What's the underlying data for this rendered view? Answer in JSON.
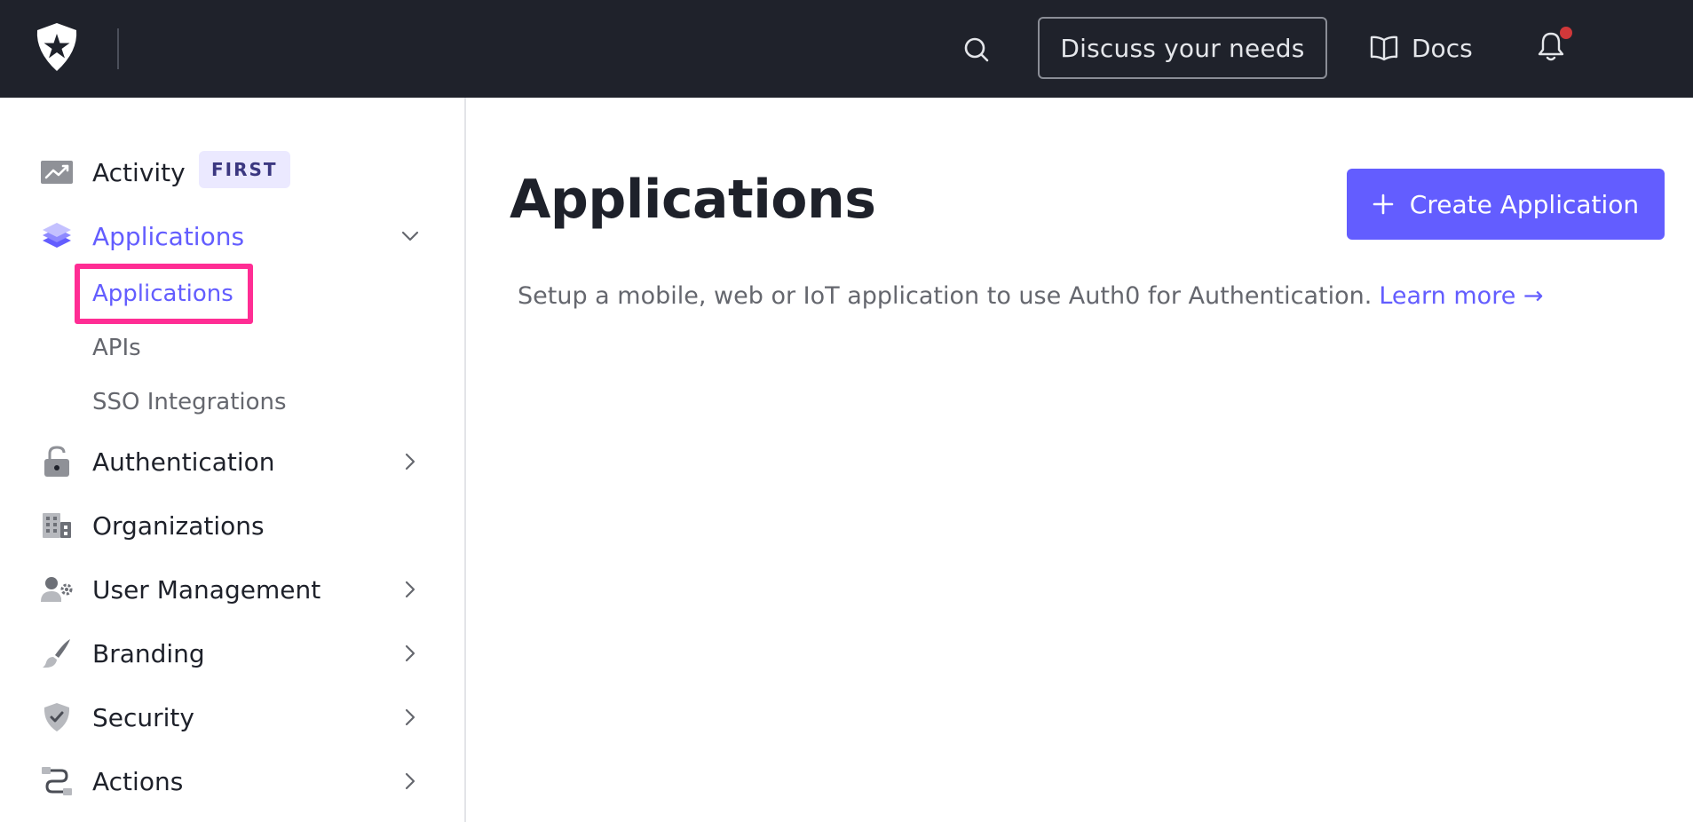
{
  "topbar": {
    "logo_icon": "auth0-star-shield-icon",
    "search_icon": "search-icon",
    "discuss_label": "Discuss your needs",
    "docs_label": "Docs",
    "docs_icon": "book-icon",
    "bell_icon": "bell-icon",
    "has_notification": true
  },
  "sidebar": {
    "items": [
      {
        "label": "Activity",
        "icon": "trending-chart-icon",
        "badge": "FIRST",
        "chevron": null
      },
      {
        "label": "Applications",
        "icon": "layers-icon",
        "active": true,
        "chevron": "chevron-down-icon",
        "children": [
          {
            "label": "Applications",
            "active": true
          },
          {
            "label": "APIs"
          },
          {
            "label": "SSO Integrations"
          }
        ]
      },
      {
        "label": "Authentication",
        "icon": "lock-icon",
        "chevron": "chevron-right-icon"
      },
      {
        "label": "Organizations",
        "icon": "building-icon",
        "chevron": null
      },
      {
        "label": "User Management",
        "icon": "user-gear-icon",
        "chevron": "chevron-right-icon"
      },
      {
        "label": "Branding",
        "icon": "brush-icon",
        "chevron": "chevron-right-icon"
      },
      {
        "label": "Security",
        "icon": "shield-check-icon",
        "chevron": "chevron-right-icon"
      },
      {
        "label": "Actions",
        "icon": "flow-icon",
        "chevron": "chevron-right-icon"
      }
    ]
  },
  "main": {
    "title": "Applications",
    "create_button_label": "Create Application",
    "create_button_icon": "plus-icon",
    "description": "Setup a mobile, web or IoT application to use Auth0 for Authentication.",
    "learn_more_label": "Learn more →"
  },
  "colors": {
    "topbar_bg": "#1f222b",
    "accent": "#635dff",
    "highlight": "#ff2d94",
    "notification_dot": "#d0383a"
  }
}
